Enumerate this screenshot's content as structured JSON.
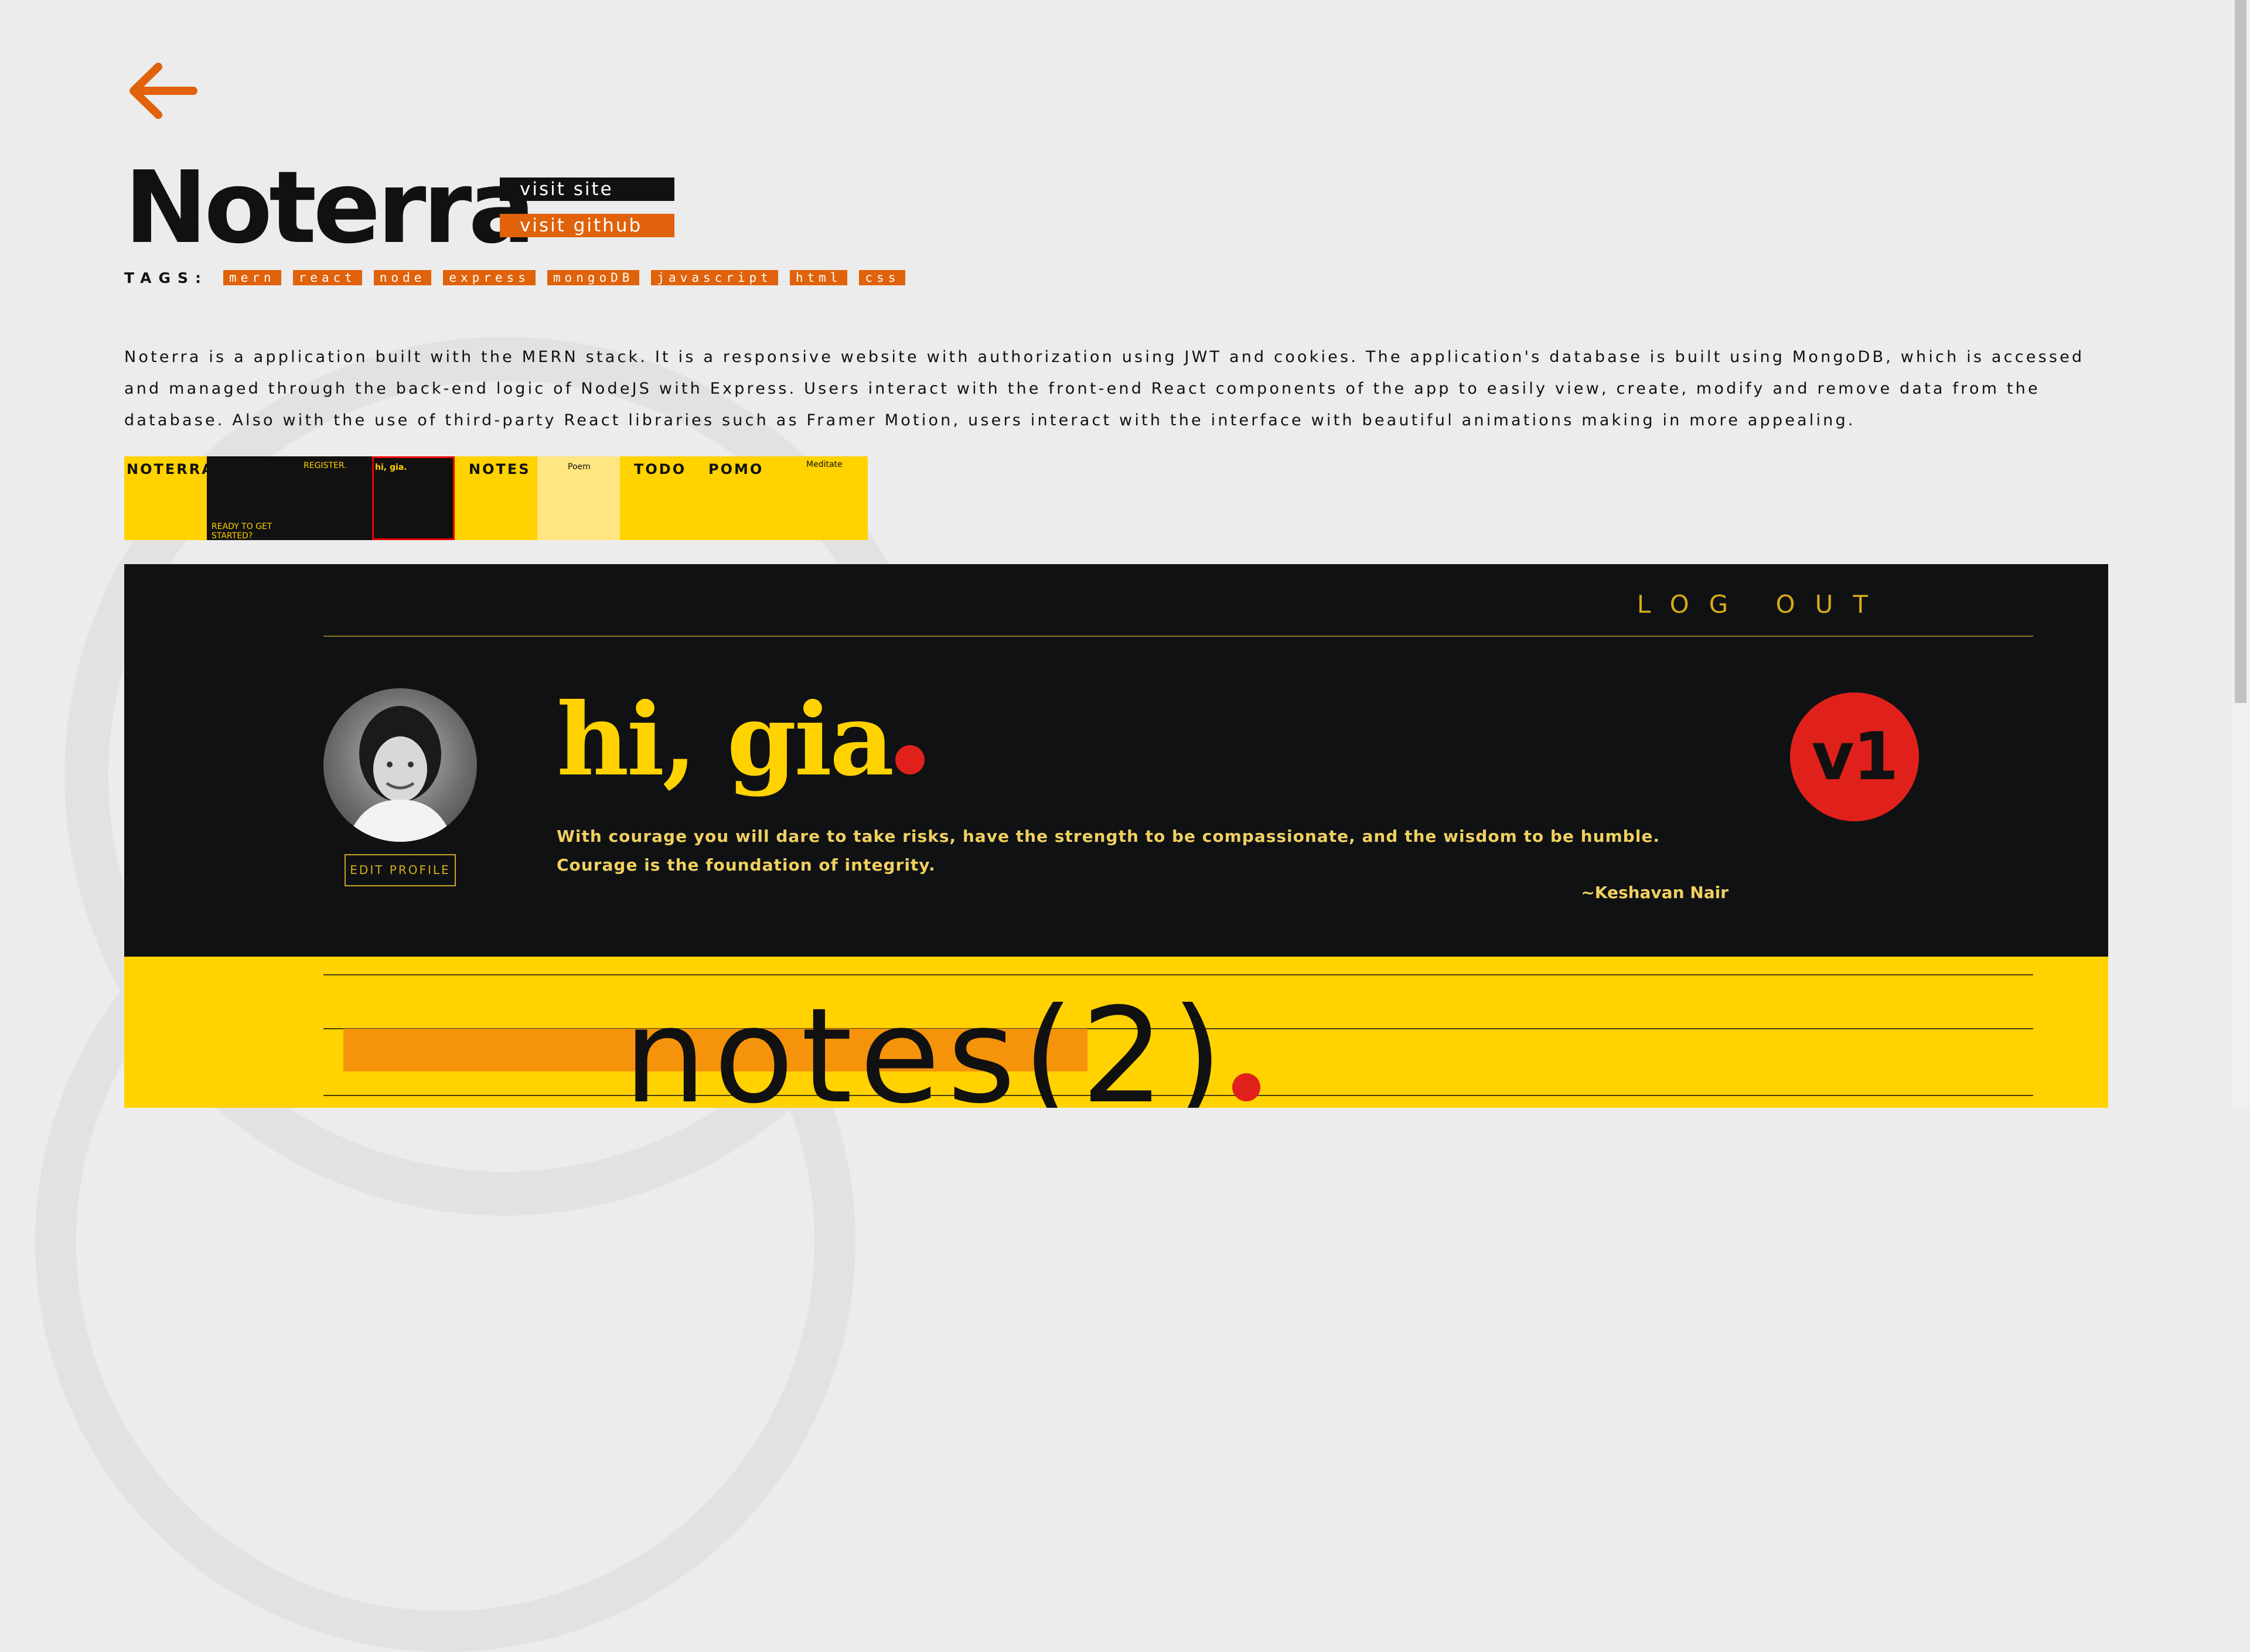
{
  "project": {
    "title": "Noterra",
    "visit_site_label": "visit site",
    "visit_github_label": "visit github",
    "tags_label": "TAGS:",
    "tags": [
      "mern",
      "react",
      "node",
      "express",
      "mongoDB",
      "javascript",
      "html",
      "css"
    ],
    "description": "Noterra is a application built with the MERN stack. It is a responsive website with authorization using JWT and cookies. The application's database is built using MongoDB, which is accessed and managed through the back-end logic of NodeJS with Express. Users interact with the front-end React components of the app to easily view, create, modify and remove data from the database. Also with the use of third-party React libraries such as Framer Motion, users interact with the interface with beautiful animations making in more appealing."
  },
  "gallery": {
    "thumbnails": [
      {
        "label": "NOTERRA",
        "style": "yellow"
      },
      {
        "label": "READY TO GET STARTED?",
        "style": "dark"
      },
      {
        "label": "REGISTER.",
        "style": "dark"
      },
      {
        "label": "hi, gia.",
        "style": "dark",
        "selected": true
      },
      {
        "label": "NOTES",
        "style": "yellow"
      },
      {
        "label": "Poem",
        "style": "pale"
      },
      {
        "label": "TODO",
        "style": "yellow"
      },
      {
        "label": "POMO",
        "style": "yellow"
      },
      {
        "label": "Meditate",
        "style": "yellow"
      }
    ]
  },
  "preview": {
    "logout_label": "LOG OUT",
    "greeting": "hi, gia",
    "edit_profile_label": "EDIT PROFILE",
    "quote": "With courage you will dare to take risks, have the strength to be compassionate, and the wisdom to be humble. Courage is the foundation of integrity.",
    "quote_author": "~Keshavan Nair",
    "version_badge": "v1",
    "notes_heading": "notes(2)"
  },
  "colors": {
    "accent_orange": "#e0620b",
    "dark": "#0f1113",
    "yellow": "#ffd200",
    "red_dot": "#e0211b",
    "background": "#ececec"
  },
  "icons": {
    "back": "arrow-left-icon"
  }
}
